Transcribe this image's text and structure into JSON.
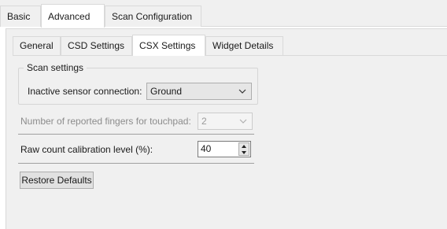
{
  "top_tabs": [
    "Basic",
    "Advanced",
    "Scan Configuration"
  ],
  "sub_tabs": [
    "General",
    "CSD Settings",
    "CSX Settings",
    "Widget Details"
  ],
  "scan_settings": {
    "title": "Scan settings",
    "inactive_label": "Inactive sensor connection:",
    "inactive_value": "Ground"
  },
  "fingers": {
    "label": "Number of reported fingers for touchpad:",
    "value": "2"
  },
  "raw_count": {
    "label": "Raw count calibration level (%):",
    "value": "40"
  },
  "restore_button": "Restore Defaults",
  "colors": {
    "background": "#f0f0f0",
    "active_tab": "#ffffff",
    "border": "#d9d9d9",
    "disabled_text": "#8c8c8c"
  },
  "icons": [
    "chevron-down-icon",
    "spin-up-icon",
    "spin-down-icon"
  ]
}
